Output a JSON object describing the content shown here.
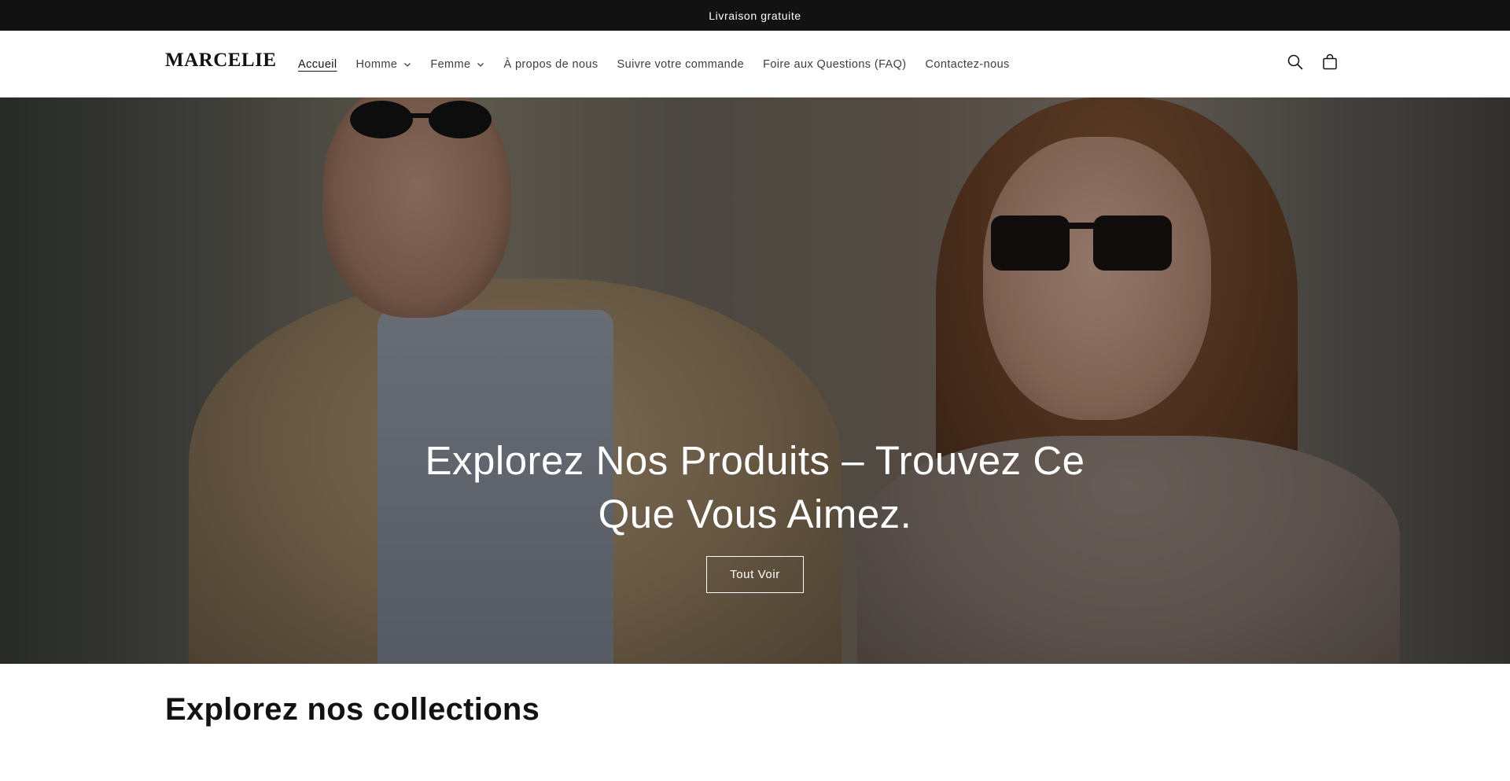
{
  "announcement": {
    "text": "Livraison gratuite"
  },
  "header": {
    "logo": "MARCELIE",
    "nav": [
      {
        "label": "Accueil",
        "active": true,
        "has_dropdown": false
      },
      {
        "label": "Homme",
        "active": false,
        "has_dropdown": true
      },
      {
        "label": "Femme",
        "active": false,
        "has_dropdown": true
      },
      {
        "label": "À propos de nous",
        "active": false,
        "has_dropdown": false
      },
      {
        "label": "Suivre votre commande",
        "active": false,
        "has_dropdown": false
      },
      {
        "label": "Foire aux Questions (FAQ)",
        "active": false,
        "has_dropdown": false
      },
      {
        "label": "Contactez-nous",
        "active": false,
        "has_dropdown": false
      }
    ],
    "icons": {
      "search": "search-icon",
      "cart": "cart-icon"
    }
  },
  "hero": {
    "title": "Explorez Nos Produits – Trouvez Ce Que Vous Aimez.",
    "button_label": "Tout Voir"
  },
  "collections": {
    "title": "Explorez nos collections"
  },
  "colors": {
    "announcement_bg": "#121212",
    "text": "#121212",
    "white": "#ffffff"
  }
}
